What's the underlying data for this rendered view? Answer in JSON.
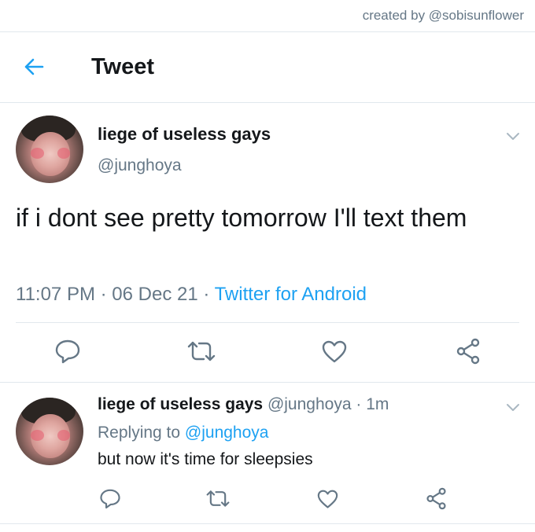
{
  "credit": "created by @sobisunflower",
  "header": {
    "title": "Tweet",
    "back_icon": "arrow-left-icon"
  },
  "main_tweet": {
    "display_name": "liege of useless gays",
    "handle": "@junghoya",
    "text": "if i dont see pretty tomorrow I'll text them",
    "time": "11:07 PM",
    "sep1": " · ",
    "date": "06 Dec 21",
    "sep2": " · ",
    "source": "Twitter for Android",
    "actions": [
      "reply-icon",
      "retweet-icon",
      "like-icon",
      "share-icon"
    ]
  },
  "reply_tweet": {
    "display_name": "liege of useless gays",
    "handle": "@junghoya",
    "time_sep": " · ",
    "time": "1m",
    "replying_prefix": "Replying to ",
    "replying_to": "@junghoya",
    "text": "but now it's time for sleepsies",
    "actions": [
      "reply-icon",
      "retweet-icon",
      "like-icon",
      "share-icon"
    ]
  },
  "colors": {
    "accent": "#1da1f2",
    "secondary_text": "#657786",
    "divider": "#e1e8ed"
  }
}
